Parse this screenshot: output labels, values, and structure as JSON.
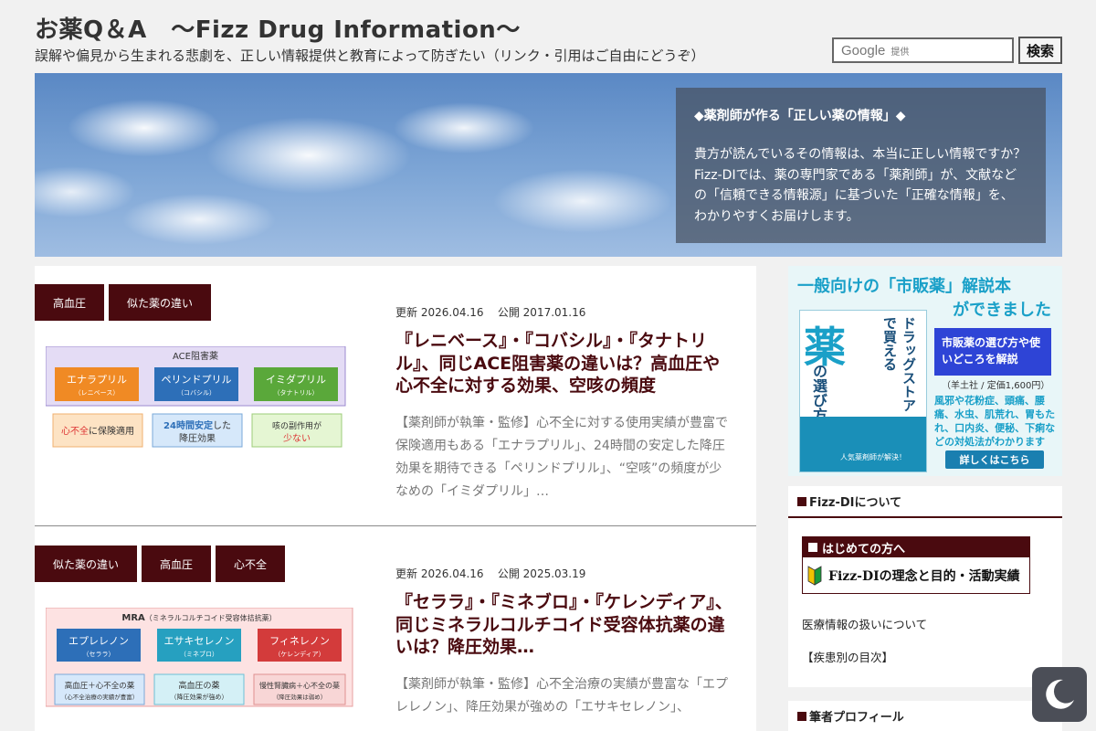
{
  "header": {
    "title": "お薬Q＆A　〜Fizz Drug Information〜",
    "description": "誤解や偏見から生まれる悲劇を、正しい情報提供と教育によって防ぎたい（リンク・引用はご自由にどうぞ）"
  },
  "search": {
    "brand": "Google",
    "brand_suffix": "提供",
    "button_label": "検索"
  },
  "hero": {
    "panel_title": "◆薬剤師が作る「正しい薬の情報」◆",
    "panel_lines": [
      "貴方が読んでいるその情報は、本当に正しい情報ですか？",
      "Fizz-DIでは、薬の専門家である「薬剤師」が、文献など",
      "の「信頼できる情報源」に基づいた「正確な情報」を、",
      "わかりやすくお届けします。"
    ]
  },
  "posts": [
    {
      "tags": [
        "高血圧",
        "似た薬の違い"
      ],
      "updated_label": "更新",
      "updated": "2026.04.16",
      "published_label": "公開",
      "published": "2017.01.16",
      "title": "『レニベース』・『コバシル』・『タナトリル』、同じACE阻害薬の違いは？高血圧や心不全に対する効果、空咳の頻度",
      "excerpt": "【薬剤師が執筆・監修】心不全に対する使用実績が豊富で保険適用もある「エナラプリル」、24時間の安定した降圧効果を期待できる「ペリンドプリル」、“空咳”の頻度が少なめの「イミダプリル」…",
      "thumb": {
        "header": "ACE阻害薬",
        "drugs": [
          {
            "name": "エナラプリル",
            "brand": "（レニベース）"
          },
          {
            "name": "ペリンドプリル",
            "brand": "（コバシル）"
          },
          {
            "name": "イミダプリル",
            "brand": "（タナトリル）"
          }
        ],
        "notes": [
          {
            "a": "心不全",
            "b": "に保険適用"
          },
          {
            "a": "24時間安定",
            "b": "した",
            "c": "降圧効果"
          },
          {
            "a": "咳の副作用が",
            "b": "少ない"
          }
        ]
      }
    },
    {
      "tags": [
        "似た薬の違い",
        "高血圧",
        "心不全"
      ],
      "updated_label": "更新",
      "updated": "2026.04.16",
      "published_label": "公開",
      "published": "2025.03.19",
      "title": "『セララ』・『ミネブロ』・『ケレンディア』、同じミネラルコルチコイド受容体抗薬の違いは？降圧効果…",
      "excerpt": "【薬剤師が執筆・監修】心不全治療の実績が豊富な「エプレレノン」、降圧効果が強めの「エサキセレノン」、",
      "thumb": {
        "header": "MRA",
        "header_sub": "（ミネラルコルチコイド受容体拮抗薬）",
        "drugs": [
          {
            "name": "エプレレノン",
            "brand": "（セララ）"
          },
          {
            "name": "エサキセレノン",
            "brand": "（ミネブロ）"
          },
          {
            "name": "フィネレノン",
            "brand": "（ケレンディア）"
          }
        ],
        "notes": [
          {
            "a": "高血圧＋心不全の薬",
            "b": "（心不全治療の実績が豊富）"
          },
          {
            "a": "高血圧の薬",
            "b": "（降圧効果が強め）"
          },
          {
            "a": "慢性腎臓病＋心不全の薬",
            "b": "（降圧効果は弱め）"
          }
        ]
      }
    }
  ],
  "sidebar": {
    "ad": {
      "heading1": "一般向けの「市販薬」解説本",
      "heading2": "ができました",
      "book_big": "薬",
      "book_vertical": "の選び方を",
      "book_vertical2": "ドラッグストアで買える",
      "book_footer": "人気薬剤師が解決！",
      "feature": "市販薬の選び方や使いどころを解説",
      "price": "（羊土社 / 定価1,600円）",
      "list": "風邪や花粉症、頭痛、腰痛、水虫、肌荒れ、胃もたれ、口内炎、便秘、下痢などの対処法がわかります",
      "cta": "詳しくはこちら"
    },
    "about": {
      "title": "Fizz-DIについて",
      "banner_top": "はじめての方へ",
      "banner_body": "Fizz-DIの理念と目的・活動実績",
      "links": [
        "医療情報の扱いについて",
        "【疾患別の目次】"
      ]
    },
    "profile": {
      "title": "筆者プロフィール"
    }
  }
}
